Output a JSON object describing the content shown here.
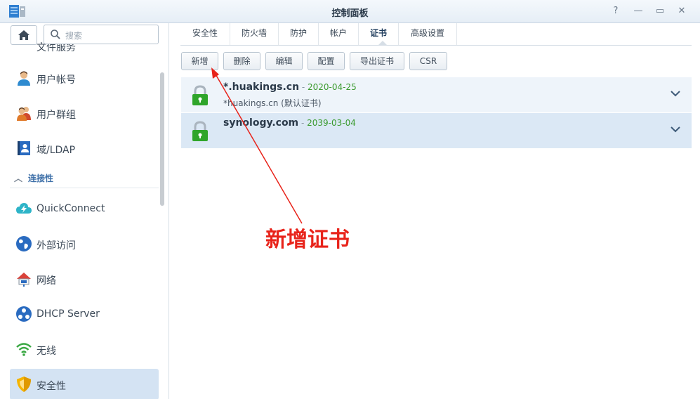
{
  "window": {
    "title": "控制面板",
    "controls": {
      "help": "?",
      "minimize": "—",
      "maximize": "▭",
      "close": "✕"
    }
  },
  "sidebar": {
    "search_placeholder": "搜索",
    "partial_item": "文件服务",
    "items": [
      {
        "label": "用户帐号",
        "icon": "user-icon"
      },
      {
        "label": "用户群组",
        "icon": "group-icon"
      },
      {
        "label": "域/LDAP",
        "icon": "ldap-icon"
      },
      {
        "label": "QuickConnect",
        "icon": "quickconnect-icon"
      },
      {
        "label": "外部访问",
        "icon": "globe-icon"
      },
      {
        "label": "网络",
        "icon": "network-icon"
      },
      {
        "label": "DHCP Server",
        "icon": "dhcp-icon"
      },
      {
        "label": "无线",
        "icon": "wifi-icon"
      },
      {
        "label": "安全性",
        "icon": "shield-icon",
        "active": true
      }
    ],
    "section_title": "连接性"
  },
  "tabs": [
    {
      "label": "安全性"
    },
    {
      "label": "防火墙"
    },
    {
      "label": "防护"
    },
    {
      "label": "帐户"
    },
    {
      "label": "证书",
      "active": true
    },
    {
      "label": "高级设置"
    }
  ],
  "toolbar": {
    "add": "新增",
    "delete": "删除",
    "edit": "编辑",
    "configure": "配置",
    "export": "导出证书",
    "csr": "CSR"
  },
  "certificates": [
    {
      "name": "*.huakings.cn",
      "separator": " - ",
      "expiry": "2020-04-25",
      "subtitle": "*huakings.cn (默认证书)"
    },
    {
      "name": "synology.com",
      "separator": " - ",
      "expiry": "2039-03-04",
      "subtitle": ""
    }
  ],
  "annotation": {
    "text": "新增证书",
    "color": "#e8231a"
  },
  "colors": {
    "active_bg": "#d4e3f3",
    "date_green": "#3a9a2e",
    "lock_green": "#2fa52a",
    "section_blue": "#3d6fa8"
  }
}
